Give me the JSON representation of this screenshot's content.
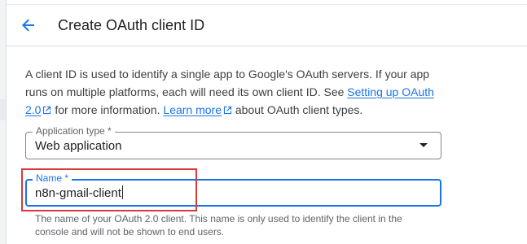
{
  "header": {
    "back_icon": "arrow-left-icon",
    "title": "Create OAuth client ID"
  },
  "intro": {
    "text_1": "A client ID is used to identify a single app to Google's OAuth servers. If your app runs on multiple platforms, each will need its own client ID. See ",
    "link_1": "Setting up OAuth 2.0",
    "text_2": " for more information. ",
    "link_2": "Learn more",
    "text_3": " about OAuth client types.",
    "link_icon": "open-in-new-icon"
  },
  "application_type": {
    "label": "Application type *",
    "value": "Web application",
    "dropdown_icon": "triangle-down-icon"
  },
  "name_field": {
    "label": "Name *",
    "value": "n8n-gmail-client",
    "helper": "The name of your OAuth 2.0 client. This name is only used to identify the client in the console and will not be shown to end users."
  },
  "colors": {
    "accent": "#1a73e8",
    "highlight": "#d93a3a",
    "text": "#202124",
    "secondary_text": "#5f6368",
    "border": "#80868b"
  }
}
